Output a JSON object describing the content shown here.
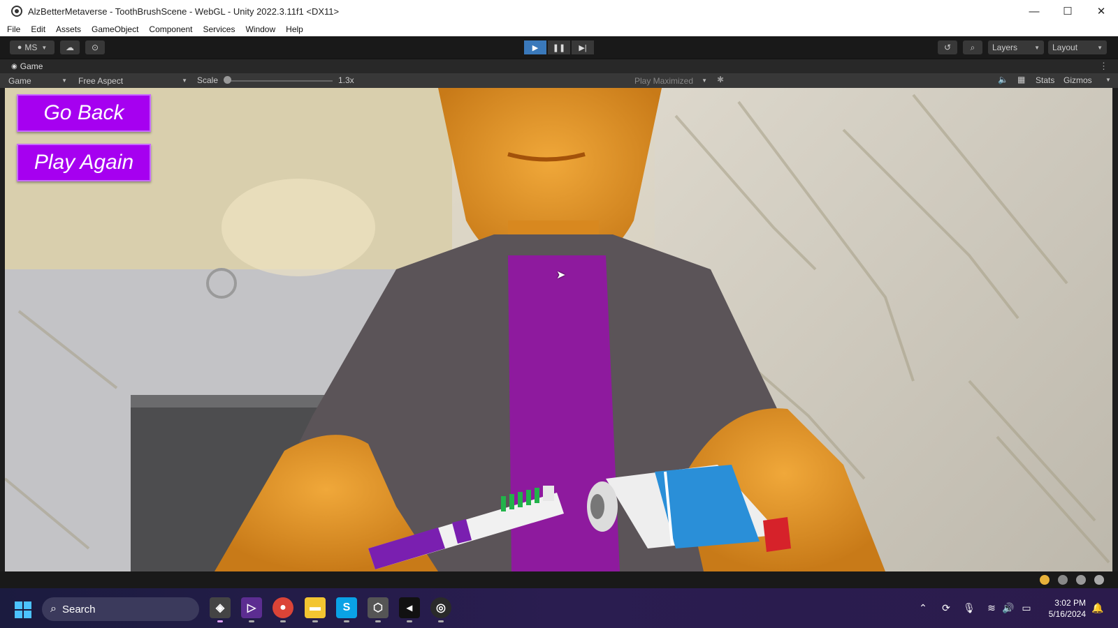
{
  "window": {
    "title": "AlzBetterMetaverse - ToothBrushScene - WebGL - Unity 2022.3.11f1 <DX11>",
    "minimize": "—",
    "maximize": "☐",
    "close": "✕"
  },
  "menu": [
    "File",
    "Edit",
    "Assets",
    "GameObject",
    "Component",
    "Services",
    "Window",
    "Help"
  ],
  "toolbar": {
    "account": "MS",
    "layers": "Layers",
    "layout": "Layout"
  },
  "tab": {
    "label": "Game"
  },
  "gamebar": {
    "display": "Game",
    "aspect": "Free Aspect",
    "scale_label": "Scale",
    "scale_value": "1.3x",
    "play_mode": "Play Maximized",
    "stats": "Stats",
    "gizmos": "Gizmos"
  },
  "game_ui": {
    "go_back": "Go Back",
    "play_again": "Play Again"
  },
  "taskbar": {
    "search": "Search",
    "time": "3:02 PM",
    "date": "5/16/2024"
  },
  "colors": {
    "game_button": "#a600f0",
    "play_active": "#3a79bb",
    "shirt": "#8e1a9e",
    "skin": "#e59a2a"
  },
  "icons": [
    "windows-icon",
    "search-icon",
    "unity-icon",
    "visual-studio-icon",
    "chrome-icon",
    "file-explorer-icon",
    "skype-icon",
    "unity-hub-icon",
    "terminal-icon",
    "obs-icon"
  ]
}
